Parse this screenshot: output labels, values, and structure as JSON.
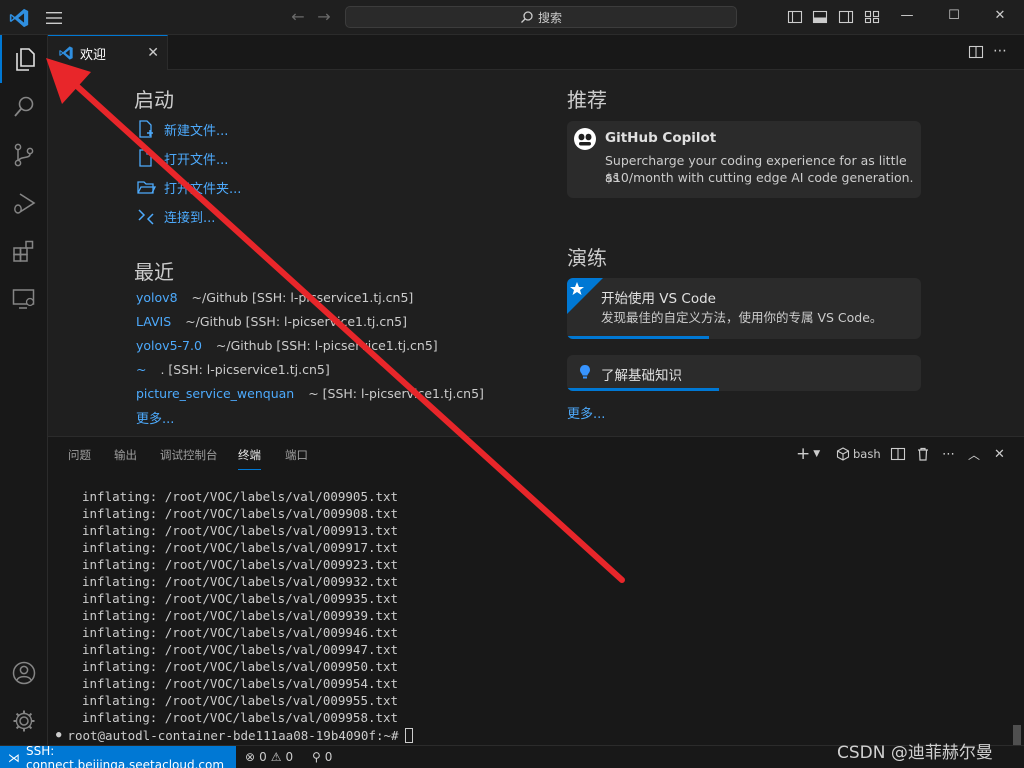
{
  "titlebar": {
    "search_placeholder": "搜索",
    "nav_back": "←",
    "nav_forward": "→",
    "minimize": "—",
    "maximize": "☐",
    "close": "✕"
  },
  "tabs": [
    {
      "label": "欢迎",
      "icon": "vscode-logo-icon"
    }
  ],
  "welcome": {
    "start": {
      "heading": "启动",
      "items": [
        {
          "label": "新建文件...",
          "icon": "new-file-icon"
        },
        {
          "label": "打开文件...",
          "icon": "open-file-icon"
        },
        {
          "label": "打开文件夹...",
          "icon": "open-folder-icon"
        },
        {
          "label": "连接到...",
          "icon": "remote-connect-icon"
        }
      ]
    },
    "recent": {
      "heading": "最近",
      "items": [
        {
          "name": "yolov8",
          "path": "~/Github [SSH: l-picservice1.tj.cn5]"
        },
        {
          "name": "LAVIS",
          "path": "~/Github [SSH: l-picservice1.tj.cn5]"
        },
        {
          "name": "yolov5-7.0",
          "path": "~/Github [SSH: l-picservice1.tj.cn5]"
        },
        {
          "name": "~",
          "path": ". [SSH: l-picservice1.tj.cn5]"
        },
        {
          "name": "picture_service_wenquan",
          "path": "~ [SSH: l-picservice1.tj.cn5]"
        }
      ],
      "more": "更多..."
    },
    "recommend": {
      "heading": "推荐",
      "card": {
        "title": "GitHub Copilot",
        "desc_line1": "Supercharge your coding experience for as little as",
        "desc_line2": "$10/month with cutting edge AI code generation."
      }
    },
    "walkthroughs": {
      "heading": "演练",
      "cards": [
        {
          "title": "开始使用 VS Code",
          "desc": "发现最佳的自定义方法，使用你的专属 VS Code。",
          "progress": 0.4
        },
        {
          "title": "了解基础知识",
          "progress": 0.43
        }
      ],
      "more": "更多..."
    }
  },
  "panel": {
    "tabs": [
      "问题",
      "输出",
      "调试控制台",
      "终端",
      "端口"
    ],
    "active_tab": "终端",
    "shell": "bash",
    "terminal_lines": [
      "inflating: /root/VOC/labels/val/009905.txt",
      "inflating: /root/VOC/labels/val/009908.txt",
      "inflating: /root/VOC/labels/val/009913.txt",
      "inflating: /root/VOC/labels/val/009917.txt",
      "inflating: /root/VOC/labels/val/009923.txt",
      "inflating: /root/VOC/labels/val/009932.txt",
      "inflating: /root/VOC/labels/val/009935.txt",
      "inflating: /root/VOC/labels/val/009939.txt",
      "inflating: /root/VOC/labels/val/009946.txt",
      "inflating: /root/VOC/labels/val/009947.txt",
      "inflating: /root/VOC/labels/val/009950.txt",
      "inflating: /root/VOC/labels/val/009954.txt",
      "inflating: /root/VOC/labels/val/009955.txt",
      "inflating: /root/VOC/labels/val/009958.txt"
    ],
    "prompt": "root@autodl-container-bde111aa08-19b4090f:~#"
  },
  "statusbar": {
    "remote": "SSH: connect.beijinga.seetacloud.com",
    "errors": "0",
    "warnings": "0",
    "ports": "0"
  },
  "watermark": "CSDN @迪菲赫尔曼",
  "colors": {
    "accent": "#0078d4",
    "link": "#4daafc",
    "arrow": "#e8262a"
  }
}
